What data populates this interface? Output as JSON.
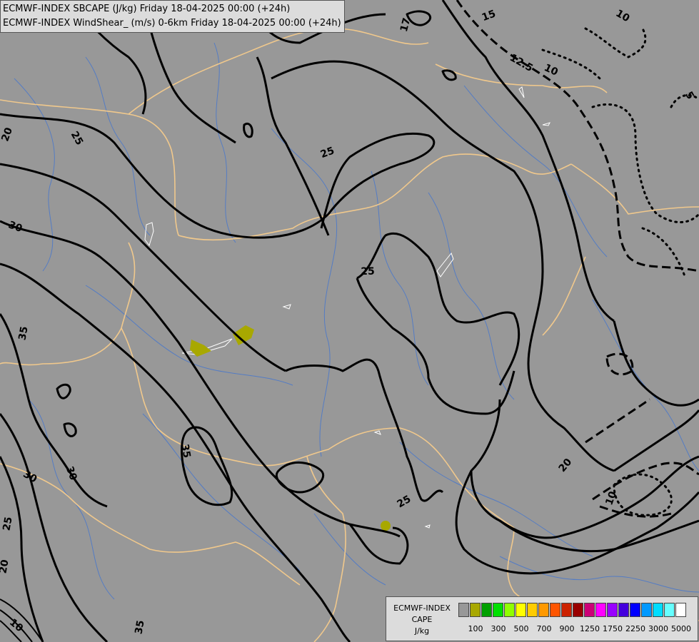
{
  "titles": {
    "line1": "ECMWF-INDEX SBCAPE (J/kg) Friday 18-04-2025 00:00 (+24h)",
    "line2": "ECMWF-INDEX WindShear_ (m/s) 0-6km Friday 18-04-2025 00:00 (+24h)"
  },
  "legend": {
    "title_lines": [
      "ECMWF-INDEX",
      "CAPE",
      "J/kg"
    ],
    "colors": [
      "#989898",
      "#a8a800",
      "#00a000",
      "#00e000",
      "#90ff00",
      "#ffff00",
      "#ffcc00",
      "#ff9900",
      "#ff5500",
      "#cc2200",
      "#990000",
      "#cc0077",
      "#ff00ff",
      "#9900ff",
      "#4400dd",
      "#0000ff",
      "#0099ff",
      "#00ddff",
      "#66ffff",
      "#ffffff"
    ],
    "tick_labels": [
      "100",
      "300",
      "500",
      "700",
      "900",
      "1250",
      "1750",
      "2250",
      "3000",
      "5000"
    ]
  },
  "contour_labels": [
    "20",
    "17",
    "15",
    "12.5",
    "10",
    "10",
    "5",
    "25",
    "20",
    "25",
    "25",
    "30",
    "35",
    "35",
    "30",
    "30",
    "25",
    "20",
    "25",
    "20",
    "10",
    "10",
    "35",
    "25"
  ]
}
